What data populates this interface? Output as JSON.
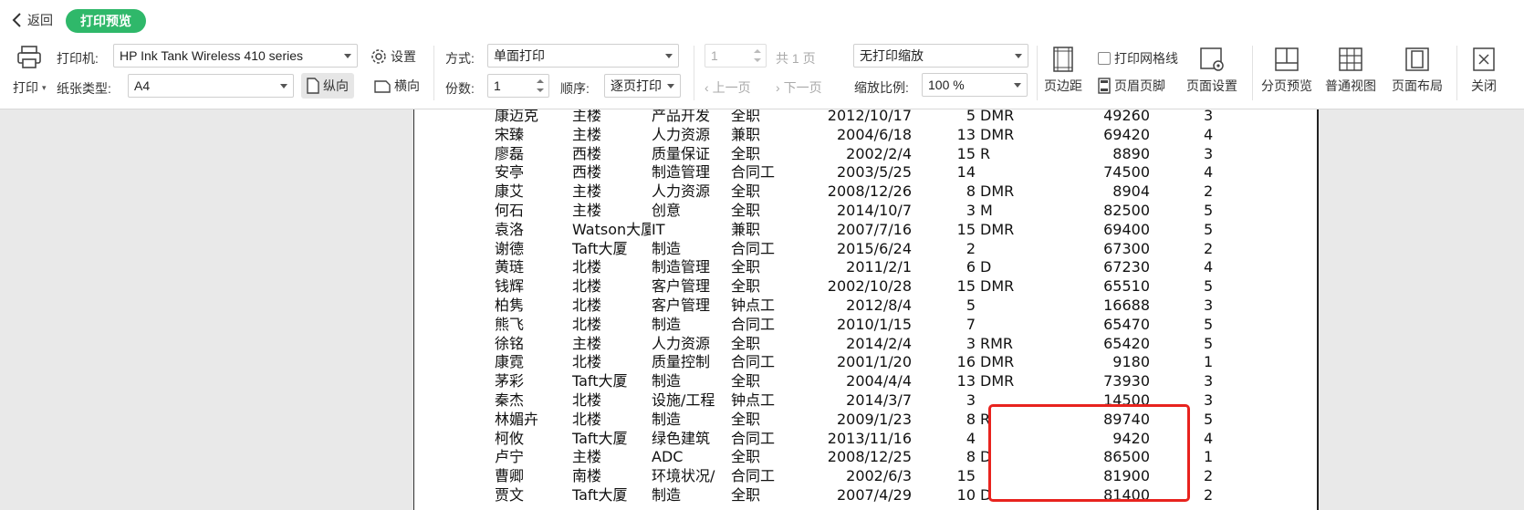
{
  "topbar": {
    "back_label": "返回",
    "title": "打印预览"
  },
  "printer": {
    "printer_label": "打印机:",
    "printer_value": "HP Ink Tank Wireless 410 series",
    "settings_label": "设置",
    "print_label": "打印",
    "paper_label": "纸张类型:",
    "paper_value": "A4",
    "portrait_label": "纵向",
    "landscape_label": "横向"
  },
  "mode": {
    "method_label": "方式:",
    "method_value": "单面打印",
    "copies_label": "份数:",
    "copies_value": "1",
    "order_label": "顺序:",
    "order_value": "逐页打印"
  },
  "pages": {
    "page_value": "1",
    "total_label": "共 1 页",
    "prev_label": "上一页",
    "next_label": "下一页"
  },
  "scale": {
    "mode_value": "无打印缩放",
    "ratio_label": "缩放比例:",
    "ratio_value": "100 %"
  },
  "tools": {
    "margins_label": "页边距",
    "gridlines_label": "打印网格线",
    "header_footer_label": "页眉页脚",
    "page_setup_label": "页面设置",
    "page_break_label": "分页预览",
    "normal_view_label": "普通视图",
    "page_layout_label": "页面布局",
    "close_label": "关闭"
  },
  "sheet": {
    "rows": [
      [
        "康迈克",
        "主楼",
        "产品开发",
        "全职",
        "2012/10/17",
        "5",
        "DMR",
        "49260",
        "3"
      ],
      [
        "宋臻",
        "主楼",
        "人力资源",
        "兼职",
        "2004/6/18",
        "13",
        "DMR",
        "69420",
        "4"
      ],
      [
        "廖磊",
        "西楼",
        "质量保证",
        "全职",
        "2002/2/4",
        "15",
        "R",
        "8890",
        "3"
      ],
      [
        "安亭",
        "西楼",
        "制造管理",
        "合同工",
        "2003/5/25",
        "14",
        "",
        "74500",
        "4"
      ],
      [
        "康艾",
        "主楼",
        "人力资源",
        "全职",
        "2008/12/26",
        "8",
        "DMR",
        "8904",
        "2"
      ],
      [
        "何石",
        "主楼",
        "创意",
        "全职",
        "2014/10/7",
        "3",
        "M",
        "82500",
        "5"
      ],
      [
        "袁洛",
        "Watson大厦",
        "IT",
        "兼职",
        "2007/7/16",
        "15",
        "DMR",
        "69400",
        "5"
      ],
      [
        "谢德",
        "Taft大厦",
        "制造",
        "合同工",
        "2015/6/24",
        "2",
        "",
        "67300",
        "2"
      ],
      [
        "黄琏",
        "北楼",
        "制造管理",
        "全职",
        "2011/2/1",
        "6",
        "D",
        "67230",
        "4"
      ],
      [
        "钱辉",
        "北楼",
        "客户管理",
        "全职",
        "2002/10/28",
        "15",
        "DMR",
        "65510",
        "5"
      ],
      [
        "柏隽",
        "北楼",
        "客户管理",
        "钟点工",
        "2012/8/4",
        "5",
        "",
        "16688",
        "3"
      ],
      [
        "熊飞",
        "北楼",
        "制造",
        "合同工",
        "2010/1/15",
        "7",
        "",
        "65470",
        "5"
      ],
      [
        "徐铭",
        "主楼",
        "人力资源",
        "全职",
        "2014/2/4",
        "3",
        "RMR",
        "65420",
        "5"
      ],
      [
        "康霓",
        "北楼",
        "质量控制",
        "合同工",
        "2001/1/20",
        "16",
        "DMR",
        "9180",
        "1"
      ],
      [
        "茅彩",
        "Taft大厦",
        "制造",
        "全职",
        "2004/4/4",
        "13",
        "DMR",
        "73930",
        "3"
      ],
      [
        "秦杰",
        "北楼",
        "设施/工程",
        "钟点工",
        "2014/3/7",
        "3",
        "",
        "14500",
        "3"
      ],
      [
        "林媚卉",
        "北楼",
        "制造",
        "全职",
        "2009/1/23",
        "8",
        "R",
        "89740",
        "5"
      ],
      [
        "柯攸",
        "Taft大厦",
        "绿色建筑",
        "合同工",
        "2013/11/16",
        "4",
        "",
        "9420",
        "4"
      ],
      [
        "卢宁",
        "主楼",
        "ADC",
        "全职",
        "2008/12/25",
        "8",
        "D",
        "86500",
        "1"
      ],
      [
        "曹卿",
        "南楼",
        "环境状况/",
        "合同工",
        "2002/6/3",
        "15",
        "",
        "81900",
        "2"
      ],
      [
        "贾文",
        "Taft大厦",
        "制造",
        "全职",
        "2007/4/29",
        "10",
        "D",
        "81400",
        "2"
      ]
    ]
  }
}
